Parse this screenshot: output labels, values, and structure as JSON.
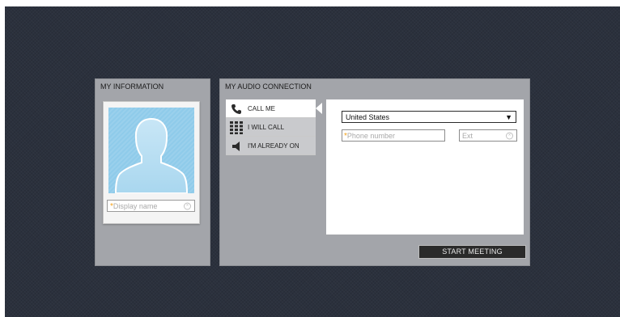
{
  "my_information": {
    "title": "MY INFORMATION",
    "display_name": {
      "required_mark": "*",
      "placeholder": "Display name"
    }
  },
  "audio_connection": {
    "title": "MY AUDIO CONNECTION",
    "tabs": [
      {
        "label": "CALL ME",
        "icon": "phone-icon",
        "active": true
      },
      {
        "label": "I WILL CALL",
        "icon": "keypad-icon",
        "active": false
      },
      {
        "label": "I'M ALREADY ON",
        "icon": "speaker-icon",
        "active": false
      }
    ],
    "country_select": {
      "value": "United States"
    },
    "phone_field": {
      "required_mark": "*",
      "placeholder": "Phone number"
    },
    "ext_field": {
      "placeholder": "Ext"
    },
    "start_button": "START MEETING"
  },
  "colors": {
    "background": "#2b313d",
    "panel": "#a3a5aa",
    "required_star": "#f3a21b",
    "avatar_bg": "#8fcbea",
    "button": "#2a2a2a"
  }
}
